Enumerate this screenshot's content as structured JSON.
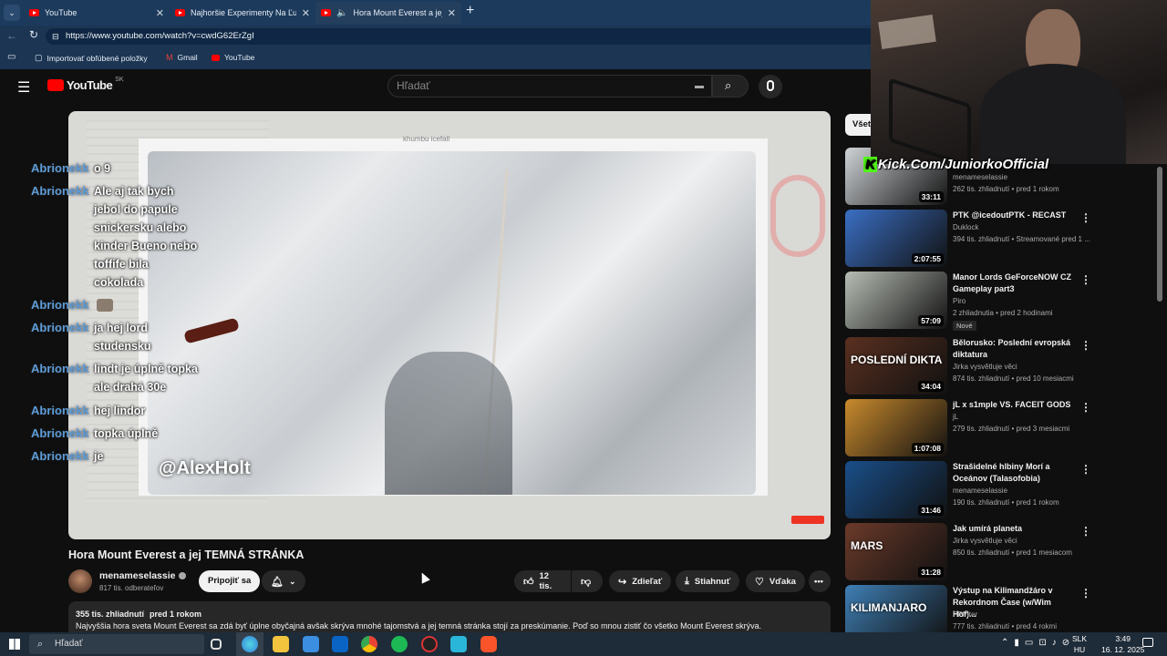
{
  "browser": {
    "tabs": [
      {
        "title": "YouTube"
      },
      {
        "title": "Najhoršie Experimenty Na Ľuďoch"
      },
      {
        "title": "Hora Mount Everest a jej TEMN"
      }
    ],
    "url": "https://www.youtube.com/watch?v=cwdG62ErZgI",
    "favorites": [
      {
        "label": "Importovať obľúbené položky"
      },
      {
        "label": "Gmail"
      },
      {
        "label": "YouTube"
      }
    ]
  },
  "yt": {
    "logo": "YouTube",
    "region": "SK",
    "search_placeholder": "Hľadať",
    "chip_all": "Všet"
  },
  "player": {
    "watermark": "@AlexHolt",
    "top_caption": "khumbu icefall"
  },
  "chat": [
    {
      "name": "Abrionekk",
      "lines": [
        "o 9"
      ]
    },
    {
      "name": "Abrionekk",
      "lines": [
        "Ale aj tak bych",
        "jebol do papule",
        "snickersku alebo",
        "kinder Bueno nebo",
        "toffife bila",
        "cokolada"
      ]
    },
    {
      "name": "Abrionekk",
      "lines": [
        ""
      ]
    },
    {
      "name": "Abrionekk",
      "lines": [
        "ja hej lord",
        "studensku"
      ]
    },
    {
      "name": "Abrionekk",
      "lines": [
        "lindt je úplně topka",
        "ale drahá 30e"
      ]
    },
    {
      "name": "Abrionekk",
      "lines": [
        "hej lindor"
      ]
    },
    {
      "name": "Abrionekk",
      "lines": [
        "topka úplně"
      ]
    },
    {
      "name": "Abrionekk",
      "lines": [
        "je"
      ]
    }
  ],
  "video": {
    "title": "Hora Mount Everest a jej TEMNÁ STRÁNKA",
    "channel": "menameselassie",
    "subscribers": "817 tis. odberateľov",
    "join": "Pripojiť sa",
    "likes": "12 tis.",
    "share": "Zdieľať",
    "download": "Stiahnuť",
    "thanks": "Vďaka",
    "views": "355 tis. zhliadnutí",
    "age": "pred 1 rokom",
    "description": "Najvyššia hora sveta Mount Everest sa zdá byť úplne obyčajná avšak skrýva mnohé tajomstvá a jej temná stránka stojí za preskúmanie. Poď so mnou zistiť čo všetko Mount Everest skrýva."
  },
  "overlay": {
    "kick": "Kick.Com/JuniorkoOfficial"
  },
  "related": [
    {
      "title": "",
      "channel": "menameselassie",
      "meta": "262 tis. zhliadnutí • pred 1 rokom",
      "duration": "33:11",
      "thumb": "#cfd3d6"
    },
    {
      "title": "PTK @icedoutPTK - RECAST",
      "channel": "Duklock",
      "meta": "394 tis. zhliadnutí • Streamované pred 1 ...",
      "duration": "2:07:55",
      "thumb": "#3a6fc4"
    },
    {
      "title": "Manor Lords GeForceNOW CZ Gameplay part3",
      "channel": "Piro",
      "meta": "2 zhliadnutia • pred 2 hodinami",
      "duration": "57:09",
      "thumb": "#b7bdb4",
      "badge": "Nové"
    },
    {
      "title": "Bělorusko: Poslední evropská diktatura",
      "channel": "Jirka vysvětluje věci",
      "meta": "874 tis. zhliadnutí • pred 10 mesiacmi",
      "duration": "34:04",
      "thumb": "#5a3020",
      "overlay_text": "POSLEDNÍ DIKTA"
    },
    {
      "title": "jL x s1mple VS. FACEIT GODS",
      "channel": "jL",
      "meta": "279 tis. zhliadnutí • pred 3 mesiacmi",
      "duration": "1:07:08",
      "thumb": "#c98a2d"
    },
    {
      "title": "Strašidelné hlbiny Morí a Oceánov (Talasofobia)",
      "channel": "menameselassie",
      "meta": "190 tis. zhliadnutí • pred 1 rokom",
      "duration": "31:46",
      "thumb": "#1a4f8a"
    },
    {
      "title": "Jak umírá planeta",
      "channel": "Jirka vysvětluje věci",
      "meta": "850 tis. zhliadnutí • pred 1 mesiacom",
      "duration": "31:28",
      "thumb": "#6b3a2a",
      "overlay_text": "MARS"
    },
    {
      "title": "Výstup na Kilimandžáro v Rekordnom Čase (w/Wim Hof)...",
      "channel": "PPPiter",
      "meta": "777 tis. zhliadnutí • pred 4 rokmi",
      "duration": "",
      "thumb": "#3f7fb5",
      "overlay_text": "KILIMANJARO"
    }
  ],
  "taskbar": {
    "search": "Hľadať",
    "lang_top": "SLK",
    "lang_bottom": "HU",
    "time": "3:49",
    "date": "16. 12. 2025"
  }
}
